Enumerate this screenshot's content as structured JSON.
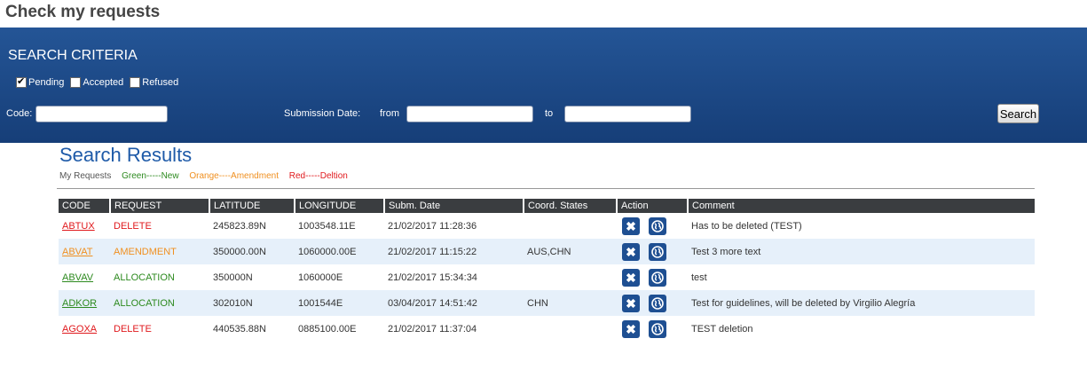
{
  "page": {
    "title": "Check my requests"
  },
  "search": {
    "title": "SEARCH CRITERIA",
    "checkboxes": [
      {
        "label": "Pending",
        "checked": true
      },
      {
        "label": "Accepted",
        "checked": false
      },
      {
        "label": "Refused",
        "checked": false
      }
    ],
    "code_label": "Code:",
    "code_value": "",
    "submission_label": "Submission Date:",
    "from_label": "from",
    "to_label": "to",
    "from_value": "",
    "to_value": "",
    "button_label": "Search"
  },
  "results": {
    "title": "Search Results",
    "legend": {
      "label": "My Requests",
      "new": "Green-----New",
      "amendment": "Orange----Amendment",
      "deletion": "Red-----Deltion"
    },
    "columns": [
      "CODE",
      "REQUEST",
      "LATITUDE",
      "LONGITUDE",
      "Subm. Date",
      "Coord. States",
      "Action",
      "Comment"
    ],
    "rows": [
      {
        "code": "ABTUX",
        "request": "DELETE",
        "latitude": "245823.89N",
        "longitude": "1003548.11E",
        "date": "21/02/2017 11:28:36",
        "states": "",
        "comment": "Has to be deleted (TEST)",
        "color": "#e0191d"
      },
      {
        "code": "ABVAT",
        "request": "AMENDMENT",
        "latitude": "350000.00N",
        "longitude": "1060000.00E",
        "date": "21/02/2017 11:15:22",
        "states": "AUS,CHN",
        "comment": "Test 3 more text",
        "color": "#f09020"
      },
      {
        "code": "ABVAV",
        "request": "ALLOCATION",
        "latitude": "350000N",
        "longitude": "1060000E",
        "date": "21/02/2017 15:34:34",
        "states": "",
        "comment": "test",
        "color": "#2d8a1f"
      },
      {
        "code": "ADKOR",
        "request": "ALLOCATION",
        "latitude": "302010N",
        "longitude": "1001544E",
        "date": "03/04/2017 14:51:42",
        "states": "CHN",
        "comment": "Test for guidelines, will be deleted by Virgilio Alegría",
        "color": "#2d8a1f"
      },
      {
        "code": "AGOXA",
        "request": "DELETE",
        "latitude": "440535.88N",
        "longitude": "0885100.00E",
        "date": "21/02/2017 11:37:04",
        "states": "",
        "comment": "TEST deletion",
        "color": "#e0191d"
      }
    ],
    "action_icons": [
      "close-icon",
      "globe-icon"
    ]
  },
  "colors": {
    "panel": "#1b4784",
    "results_title": "#1e5aa8",
    "header": "#3a3d40",
    "alt_row": "#e6f0fa",
    "new": "#2d8a1f",
    "amendment": "#f09020",
    "deletion": "#e0191d"
  }
}
